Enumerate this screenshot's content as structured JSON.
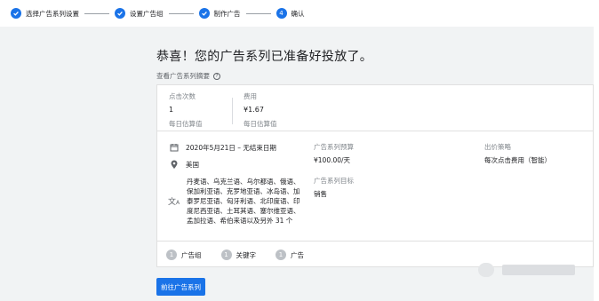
{
  "stepper": {
    "steps": [
      {
        "label": "选择广告系列设置",
        "state": "done"
      },
      {
        "label": "设置广告组",
        "state": "done"
      },
      {
        "label": "制作广告",
        "state": "done"
      },
      {
        "label": "确认",
        "number": "4",
        "state": "current"
      }
    ]
  },
  "main": {
    "headline": "恭喜！您的广告系列已准备好投放了。",
    "summary_link": "查看广告系列摘要",
    "help_glyph": "?"
  },
  "metrics": [
    {
      "label": "点击次数",
      "value": "1",
      "sub": "每日估算值"
    },
    {
      "label": "费用",
      "value": "¥1.67",
      "sub": "每日估算值"
    }
  ],
  "details": {
    "date": "2020年5月21日 – 无结束日期",
    "location": "美国",
    "languages": "丹麦语、乌克兰语、乌尔都语、俄语、保加利亚语、克罗地亚语、冰岛语、加泰罗尼亚语、匈牙利语、北印度语、印度尼西亚语、土耳其语、塞尔维亚语、孟加拉语、希伯来语以及另外 31 个",
    "budget_label": "广告系列预算",
    "budget_value": "¥100.00/天",
    "goal_label": "广告系列目标",
    "goal_value": "销售",
    "bidding_label": "出价策略",
    "bidding_value": "每次点击费用（智能）"
  },
  "footer": {
    "chips": [
      {
        "count": "1",
        "label": "广告组"
      },
      {
        "count": "1",
        "label": "关键字"
      },
      {
        "count": "1",
        "label": "广告"
      }
    ]
  },
  "cta": {
    "label": "前往广告系列"
  },
  "colors": {
    "accent": "#1a73e8",
    "background": "#f1f3f4"
  }
}
